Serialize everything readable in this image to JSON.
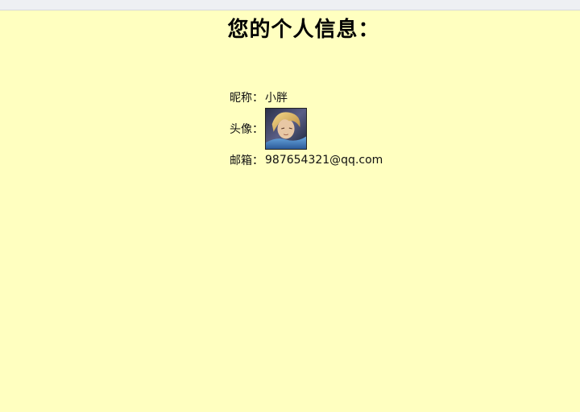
{
  "page": {
    "title": "您的个人信息："
  },
  "profile": {
    "nickname_label": "昵称：",
    "nickname_value": "小胖",
    "avatar_label": "头像：",
    "avatar_alt": "avatar",
    "email_label": "邮箱：",
    "email_value": "987654321@qq.com"
  },
  "colors": {
    "background": "#ffffc0",
    "topbar": "#eef0f3"
  }
}
